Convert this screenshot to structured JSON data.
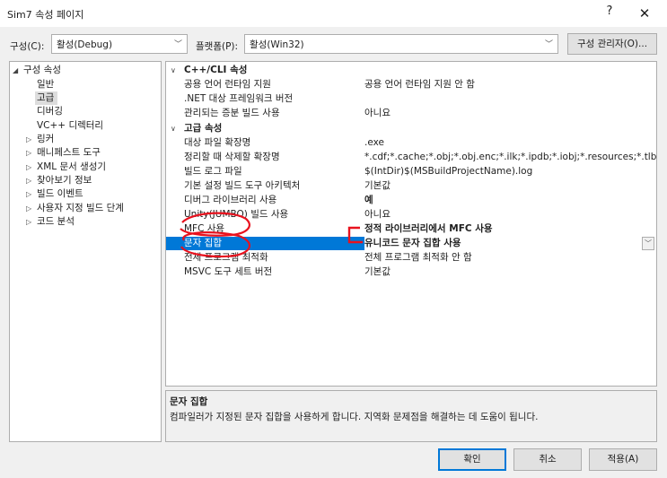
{
  "window": {
    "title": "Sim7 속성 페이지",
    "help_glyph": "?",
    "close_glyph": "✕"
  },
  "toolbar": {
    "config_label": "구성(C):",
    "config_value": "활성(Debug)",
    "platform_label": "플랫폼(P):",
    "platform_value": "활성(Win32)",
    "config_manager_button": "구성 관리자(O)...",
    "dropdown_glyph": "﹀"
  },
  "tree": {
    "items": [
      {
        "label": "구성 속성",
        "toggle": "◢"
      },
      {
        "label": "일반"
      },
      {
        "label": "고급",
        "selected": true
      },
      {
        "label": "디버깅"
      },
      {
        "label": "VC++ 디렉터리"
      },
      {
        "label": "링커",
        "toggle": "▷"
      },
      {
        "label": "매니페스트 도구",
        "toggle": "▷"
      },
      {
        "label": "XML 문서 생성기",
        "toggle": "▷"
      },
      {
        "label": "찾아보기 정보",
        "toggle": "▷"
      },
      {
        "label": "빌드 이벤트",
        "toggle": "▷"
      },
      {
        "label": "사용자 지정 빌드 단계",
        "toggle": "▷"
      },
      {
        "label": "코드 분석",
        "toggle": "▷"
      }
    ]
  },
  "grid": {
    "cat_toggle": "∨",
    "categories": [
      {
        "title": "C++/CLI 속성",
        "rows": [
          {
            "name": "공용 언어 런타임 지원",
            "value": "공용 언어 런타임 지원 안 함"
          },
          {
            "name": ".NET 대상 프레임워크 버전",
            "value": ""
          },
          {
            "name": "관리되는 증분 빌드 사용",
            "value": "아니요"
          }
        ]
      },
      {
        "title": "고급 속성",
        "rows": [
          {
            "name": "대상 파일 확장명",
            "value": ".exe"
          },
          {
            "name": "정리할 때 삭제할 확장명",
            "value": "*.cdf;*.cache;*.obj;*.obj.enc;*.ilk;*.ipdb;*.iobj;*.resources;*.tlb;*.tli;*.tlh;*.t"
          },
          {
            "name": "빌드 로그 파일",
            "value": "$(IntDir)$(MSBuildProjectName).log"
          },
          {
            "name": "기본 설정 빌드 도구 아키텍처",
            "value": "기본값"
          },
          {
            "name": "디버그 라이브러리 사용",
            "value": "예",
            "bold": true
          },
          {
            "name": "Unity(JUMBO) 빌드 사용",
            "value": "아니요"
          },
          {
            "name": "MFC 사용",
            "value": "정적 라이브러리에서 MFC 사용",
            "bold": true
          },
          {
            "name": "문자 집합",
            "value": "유니코드 문자 집합 사용",
            "bold": true,
            "selected": true
          },
          {
            "name": "전체 프로그램 최적화",
            "value": "전체 프로그램 최적화 안 함"
          },
          {
            "name": "MSVC 도구 세트 버전",
            "value": "기본값"
          }
        ]
      }
    ]
  },
  "description": {
    "title": "문자 집합",
    "text": "컴파일러가 지정된 문자 집합을 사용하게 합니다. 지역화 문제점을 해결하는 데 도움이 됩니다."
  },
  "buttons": {
    "ok": "확인",
    "cancel": "취소",
    "apply": "적용(A)"
  },
  "colors": {
    "selection": "#0078d7",
    "annotation": "#e8121e"
  }
}
